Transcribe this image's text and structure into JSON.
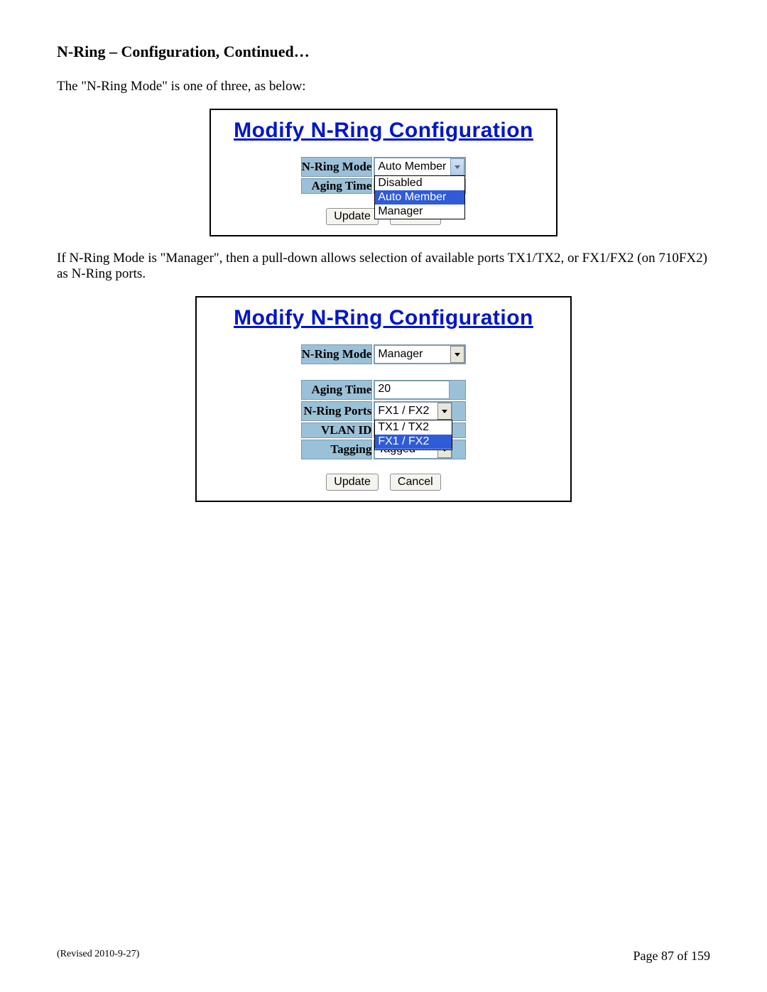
{
  "section_title": "N-Ring – Configuration, Continued…",
  "intro_text": "The \"N-Ring Mode\" is one of three, as below:",
  "panel_title": "Modify N-Ring Configuration",
  "panel1": {
    "mode_label": "N-Ring Mode",
    "mode_value": "Auto Member",
    "options": {
      "o1": "Disabled",
      "o2": "Auto Member",
      "o3": "Manager"
    },
    "aging_label": "Aging Time"
  },
  "mid_text": "If N-Ring Mode is \"Manager\", then a pull-down allows selection of available ports TX1/TX2, or FX1/FX2 (on 710FX2) as N-Ring ports.",
  "panel2": {
    "mode_label": "N-Ring Mode",
    "mode_value": "Manager",
    "aging_label": "Aging Time",
    "aging_value": "20",
    "ports_label": "N-Ring Ports",
    "ports_value": "FX1 / FX2",
    "ports_options": {
      "o1": "TX1 / TX2",
      "o2": "FX1 / FX2"
    },
    "vlan_label": "VLAN ID",
    "tagging_label": "Tagging",
    "tagging_value": "Tagged"
  },
  "buttons": {
    "update": "Update",
    "cancel": "Cancel"
  },
  "footer": {
    "revised": "(Revised 2010-9-27)",
    "page": "Page 87 of 159"
  }
}
